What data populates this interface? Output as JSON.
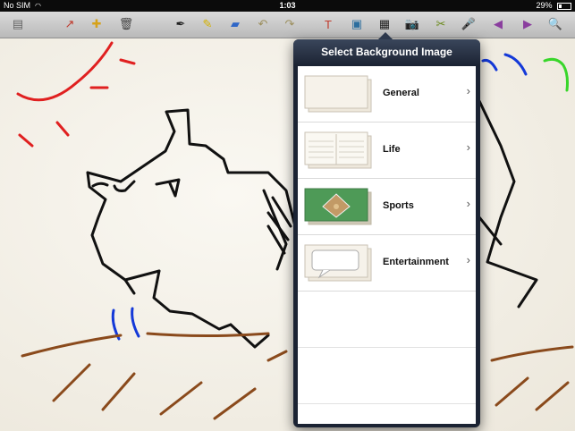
{
  "status_bar": {
    "carrier": "No SIM",
    "wifi_icon": "wifi-icon",
    "time": "1:03",
    "battery_percent": "29%",
    "battery_icon": "battery-icon"
  },
  "toolbar": {
    "tools": [
      {
        "name": "page-icon",
        "glyph": "▤",
        "color": "#666"
      },
      {
        "name": "share-icon",
        "glyph": "↗",
        "color": "#c0392b"
      },
      {
        "name": "add-icon",
        "glyph": "✚",
        "color": "#d6a21a"
      },
      {
        "name": "trash-icon",
        "glyph": "🗑",
        "color": "#444"
      },
      {
        "name": "pen-icon",
        "glyph": "✒",
        "color": "#222"
      },
      {
        "name": "pencil-icon",
        "glyph": "✎",
        "color": "#d4b100"
      },
      {
        "name": "eraser-icon",
        "glyph": "▰",
        "color": "#2e66c7"
      },
      {
        "name": "undo-icon",
        "glyph": "↶",
        "color": "#9c8f5e"
      },
      {
        "name": "redo-icon",
        "glyph": "↷",
        "color": "#9c8f5e"
      },
      {
        "name": "text-icon",
        "glyph": "T",
        "color": "#c0392b"
      },
      {
        "name": "image-icon",
        "glyph": "▣",
        "color": "#2b6e9e"
      },
      {
        "name": "background-icon",
        "glyph": "▦",
        "color": "#222"
      },
      {
        "name": "camera-icon",
        "glyph": "📷",
        "color": "#222"
      },
      {
        "name": "scissors-icon",
        "glyph": "✂",
        "color": "#6a8a1a"
      },
      {
        "name": "microphone-icon",
        "glyph": "🎤",
        "color": "#333"
      },
      {
        "name": "back-icon",
        "glyph": "◀",
        "color": "#8a3e9e"
      },
      {
        "name": "forward-icon",
        "glyph": "▶",
        "color": "#8a3e9e"
      },
      {
        "name": "zoom-icon",
        "glyph": "🔍",
        "color": "#333"
      }
    ]
  },
  "popover": {
    "title": "Select Background Image",
    "items": [
      {
        "label": "General",
        "thumb": "general-thumbnail",
        "chevron": "›"
      },
      {
        "label": "Life",
        "thumb": "life-thumbnail",
        "chevron": "›"
      },
      {
        "label": "Sports",
        "thumb": "sports-thumbnail",
        "chevron": "›"
      },
      {
        "label": "Entertainment",
        "thumb": "entertainment-thumbnail",
        "chevron": "›"
      }
    ]
  },
  "colors": {
    "red": "#e02020",
    "blue": "#1439d8",
    "green": "#38d62a",
    "brown": "#8a4a1c",
    "black": "#111111"
  }
}
